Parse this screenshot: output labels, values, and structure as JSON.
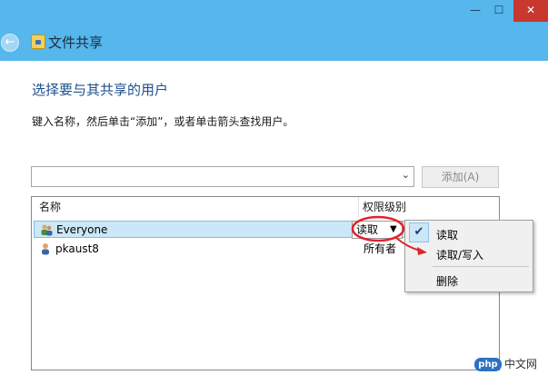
{
  "window": {
    "minimize_glyph": "—",
    "maximize_glyph": "☐",
    "close_glyph": "✕"
  },
  "header": {
    "back_glyph": "←",
    "title": "文件共享"
  },
  "main": {
    "heading": "选择要与其共享的用户",
    "instruction": "键入名称，然后单击“添加”，或者单击箭头查找用户。",
    "input": {
      "value": ""
    },
    "dropdown_glyph": "⌄",
    "add_button": "添加(A)"
  },
  "list": {
    "columns": {
      "name": "名称",
      "permission": "权限级别"
    },
    "rows": [
      {
        "name": "Everyone",
        "permission": "读取",
        "icon": "users-group-icon",
        "selected": true
      },
      {
        "name": "pkaust8",
        "permission": "所有者",
        "icon": "user-icon",
        "selected": false
      }
    ],
    "permission_dropdown_glyph": "▼"
  },
  "context_menu": {
    "check_glyph": "✔",
    "items": [
      "读取",
      "读取/写入",
      "删除"
    ]
  },
  "watermark": {
    "logo": "php",
    "text": "中文网"
  },
  "colors": {
    "titlebar": "#55b7ec",
    "heading": "#1e4f8e",
    "annotation": "#e0242a"
  }
}
